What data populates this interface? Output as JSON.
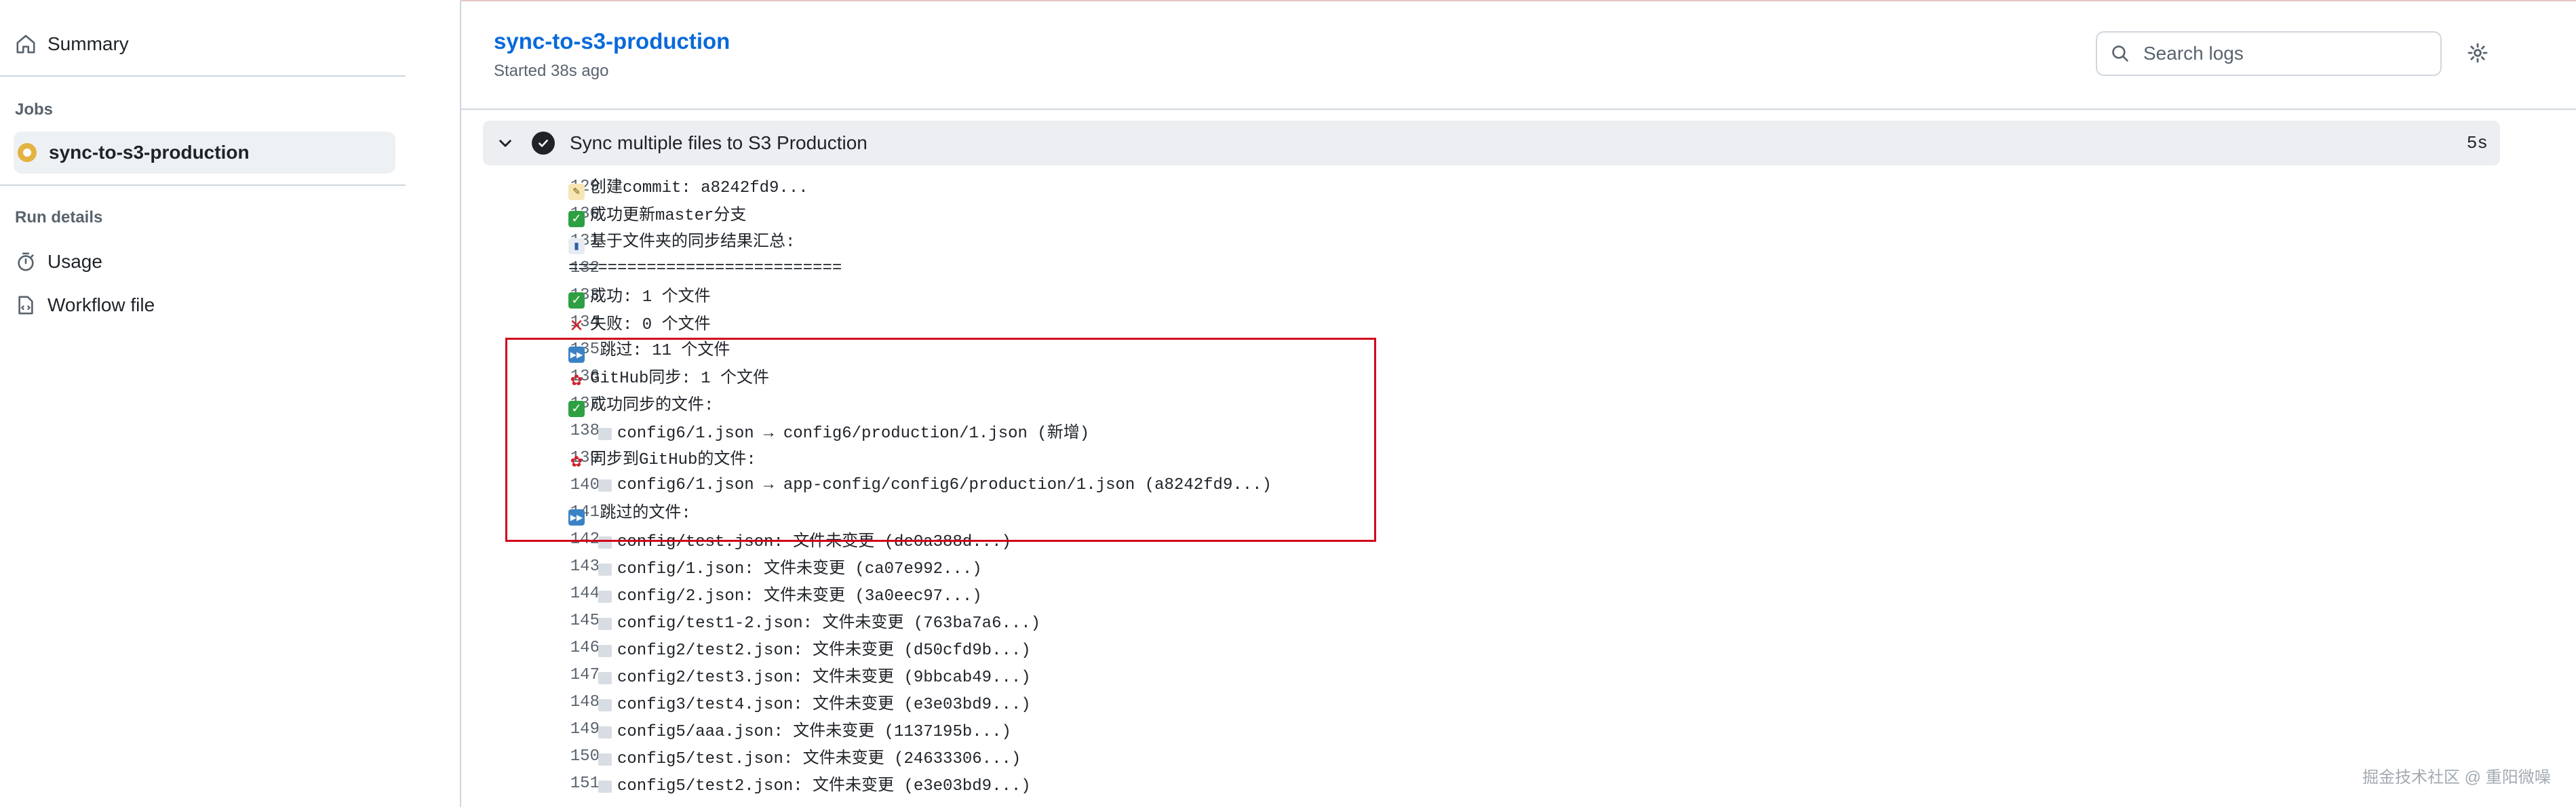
{
  "sidebar": {
    "summary_label": "Summary",
    "jobs_heading": "Jobs",
    "job_label": "sync-to-s3-production",
    "run_details_heading": "Run details",
    "usage_label": "Usage",
    "workflow_label": "Workflow file"
  },
  "header": {
    "title": "sync-to-s3-production",
    "subtitle": "Started 38s ago",
    "search_placeholder": "Search logs"
  },
  "step": {
    "name": "Sync multiple files to S3 Production",
    "duration": "5s"
  },
  "logs": [
    {
      "num": "129",
      "icon": "memo-icon",
      "text": "创建commit: a8242fd9..."
    },
    {
      "num": "130",
      "icon": "check-icon",
      "text": "成功更新master分支"
    },
    {
      "num": "131",
      "icon": "chart-icon",
      "text": "基于文件夹的同步结果汇总:"
    },
    {
      "num": "132",
      "icon": "",
      "text": "============================"
    },
    {
      "num": "133",
      "icon": "check-icon",
      "text": "成功: 1 个文件"
    },
    {
      "num": "134",
      "icon": "cross-icon",
      "text": "失败: 0 个文件"
    },
    {
      "num": "135",
      "icon": "skip-icon",
      "text": " 跳过: 11 个文件"
    },
    {
      "num": "136",
      "icon": "octopus-icon",
      "text": "GitHub同步: 1 个文件"
    },
    {
      "num": "137",
      "icon": "check-icon",
      "text": "成功同步的文件:"
    },
    {
      "num": "138",
      "icon": "folder-icon",
      "text": "config6/1.json → config6/production/1.json (新增)",
      "indent": true
    },
    {
      "num": "139",
      "icon": "octopus-icon",
      "text": "同步到GitHub的文件:"
    },
    {
      "num": "140",
      "icon": "folder-icon",
      "text": "config6/1.json → app-config/config6/production/1.json (a8242fd9...)",
      "indent": true
    },
    {
      "num": "141",
      "icon": "skip-icon",
      "text": " 跳过的文件:"
    },
    {
      "num": "142",
      "icon": "folder-icon",
      "text": "config/test.json: 文件未变更 (de0a388d...)",
      "indent": true
    },
    {
      "num": "143",
      "icon": "folder-icon",
      "text": "config/1.json: 文件未变更 (ca07e992...)",
      "indent": true
    },
    {
      "num": "144",
      "icon": "folder-icon",
      "text": "config/2.json: 文件未变更 (3a0eec97...)",
      "indent": true
    },
    {
      "num": "145",
      "icon": "folder-icon",
      "text": "config/test1-2.json: 文件未变更 (763ba7a6...)",
      "indent": true
    },
    {
      "num": "146",
      "icon": "folder-icon",
      "text": "config2/test2.json: 文件未变更 (d50cfd9b...)",
      "indent": true
    },
    {
      "num": "147",
      "icon": "folder-icon",
      "text": "config2/test3.json: 文件未变更 (9bbcab49...)",
      "indent": true
    },
    {
      "num": "148",
      "icon": "folder-icon",
      "text": "config3/test4.json: 文件未变更 (e3e03bd9...)",
      "indent": true
    },
    {
      "num": "149",
      "icon": "folder-icon",
      "text": "config5/aaa.json: 文件未变更 (1137195b...)",
      "indent": true
    },
    {
      "num": "150",
      "icon": "folder-icon",
      "text": "config5/test.json: 文件未变更 (24633306...)",
      "indent": true
    },
    {
      "num": "151",
      "icon": "folder-icon",
      "text": "config5/test2.json: 文件未变更 (e3e03bd9...)",
      "indent": true
    }
  ],
  "watermark": "掘金技术社区 @ 重阳微噪",
  "colors": {
    "link": "#0969da",
    "highlight_box": "#d0021b",
    "status_in_progress": "#e3b341"
  }
}
